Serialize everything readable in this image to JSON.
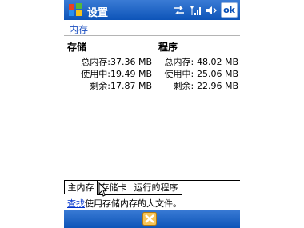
{
  "titlebar": {
    "title": "设置",
    "ok_label": "ok",
    "icons": [
      "windows-flag-icon",
      "sync-arrows-icon",
      "signal-icon",
      "speaker-icon"
    ]
  },
  "subtitle": "内存",
  "storage": {
    "header": "存储",
    "rows": [
      {
        "label": "总内存:",
        "value": "37.36 MB"
      },
      {
        "label": "使用中:",
        "value": "19.49 MB"
      },
      {
        "label": "剩余:",
        "value": "17.87 MB"
      }
    ]
  },
  "program": {
    "header": "程序",
    "rows": [
      {
        "label": "总内存:",
        "value": "48.02 MB"
      },
      {
        "label": "使用中:",
        "value": "25.06 MB"
      },
      {
        "label": "剩余:",
        "value": "22.96 MB"
      }
    ]
  },
  "tabs": [
    {
      "label": "主内存",
      "active": true
    },
    {
      "label": "存储卡",
      "active": false
    },
    {
      "label": "运行的程序",
      "active": false
    }
  ],
  "hint": {
    "link": "查找",
    "text": "使用存储内存的大文件。"
  },
  "colors": {
    "bar_blue": "#0d54b8",
    "link_blue": "#0033cc"
  }
}
